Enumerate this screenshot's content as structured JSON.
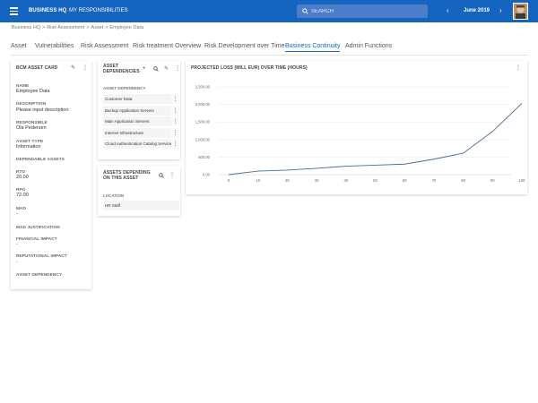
{
  "topbar": {
    "brand": "BUSINESS HQ",
    "responsibilities": "MY RESPONSIBILITIES",
    "search_placeholder": "SEARCH",
    "prev": "‹",
    "month": "June 2019",
    "next": "›"
  },
  "breadcrumb": [
    "Business HQ",
    "Risk Assessment",
    "Asset",
    "Employee Data"
  ],
  "tabs": [
    "Asset",
    "Vulnerabilities",
    "Risk Assessment",
    "Risk treatment Overview",
    "Risk Development over Time",
    "Business Continuity",
    "Admin Functions"
  ],
  "active_tab": "Business Continuity",
  "accent_color": "#1565c0",
  "bcm_card": {
    "title": "BCM ASSET CARD",
    "name_label": "NAME",
    "name": "Employee Data",
    "description_label": "DESCRIPTION",
    "description": "Please input description",
    "responsible_label": "RESPONSIBLE",
    "responsible": "Ola Pedersen",
    "asset_type_label": "ASSET TYPE",
    "asset_type": "Information",
    "dependable_label": "DEPENDABLE ASSETS",
    "rto_label": "RTO",
    "rto": "20.00",
    "rpo_label": "RPO",
    "rpo": "72.00",
    "mad_label": "MAD",
    "mad": "-",
    "mad_just_label": "MAD JUSTIFICATION",
    "financial_label": "FINANCIAL IMPACT",
    "financial": "-",
    "reputational_label": "REPUTATIONAL IMPACT",
    "reputational": "-",
    "asset_dependency_label": "ASSET DEPENDENCY"
  },
  "dependencies_card": {
    "title_line1": "ASSET",
    "title_line2": "DEPENDENCIES",
    "column": "ASSET DEPENDENCY",
    "rows": [
      "Customer Data",
      "Backup Application Servers",
      "Main Application Servers",
      "Internet Infrastructure",
      "Cloud Authentication Catalog Services"
    ]
  },
  "depending_card": {
    "title_line1": "ASSETS DEPENDING",
    "title_line2": "ON THIS ASSET",
    "column": "LOCATION",
    "rows": [
      "HR Staff"
    ]
  },
  "chart_card": {
    "title": "PROJECTED LOSS (MILL EUR) OVER TIME (HOURS)"
  },
  "chart_data": {
    "type": "line",
    "title": "PROJECTED LOSS (MILL EUR) OVER TIME (HOURS)",
    "x": [
      0,
      10,
      20,
      30,
      40,
      50,
      60,
      70,
      80,
      90,
      100
    ],
    "series": [
      {
        "values": [
          0,
          100,
          130,
          180,
          240,
          270,
          300,
          440,
          610,
          1230,
          2030
        ]
      }
    ],
    "xlim": [
      0,
      100
    ],
    "ylim": [
      0,
      2500
    ],
    "yticks": [
      "0.00",
      "500.00",
      "1,000.00",
      "1,500.00",
      "2,000.00",
      "2,500.00"
    ],
    "xticks": [
      "0",
      "10",
      "20",
      "30",
      "40",
      "50",
      "60",
      "70",
      "80",
      "90",
      "100"
    ],
    "grid": "horizontal",
    "line_color": "#4a6d96"
  }
}
